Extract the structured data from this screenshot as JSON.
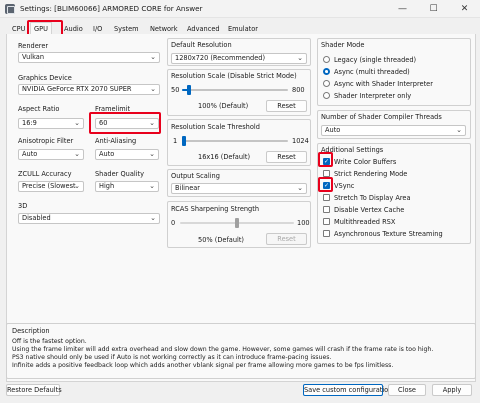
{
  "window": {
    "title": "Settings: [BLIM60066] ARMORED CORE for Answer",
    "min_glyph": "—",
    "max_glyph": "☐",
    "close_glyph": "✕"
  },
  "tabs": [
    "CPU",
    "GPU",
    "Audio",
    "I/O",
    "System",
    "Network",
    "Advanced",
    "Emulator"
  ],
  "renderer": {
    "label": "Renderer",
    "value": "Vulkan"
  },
  "graphics_device": {
    "label": "Graphics Device",
    "value": "NVIDIA GeForce RTX 2070 SUPER"
  },
  "aspect_ratio": {
    "label": "Aspect Ratio",
    "value": "16:9"
  },
  "framelimit": {
    "label": "Framelimit",
    "value": "60"
  },
  "anisotropic_filter": {
    "label": "Anisotropic Filter",
    "value": "Auto"
  },
  "anti_aliasing": {
    "label": "Anti-Aliasing",
    "value": "Auto"
  },
  "zcull_accuracy": {
    "label": "ZCULL Accuracy",
    "value": "Precise (Slowest"
  },
  "shader_quality": {
    "label": "Shader Quality",
    "value": "High"
  },
  "three_d": {
    "label": "3D",
    "value": "Disabled"
  },
  "default_resolution": {
    "label": "Default Resolution",
    "value": "1280x720 (Recommended)"
  },
  "resolution_scale": {
    "label": "Resolution Scale (Disable Strict Mode)",
    "min": "50",
    "max": "800",
    "value_text": "100% (Default)",
    "reset": "Reset",
    "min_val": 50,
    "max_val": 800,
    "value": 100
  },
  "resolution_scale_threshold": {
    "label": "Resolution Scale Threshold",
    "min": "1",
    "max": "1024",
    "value_text": "16x16 (Default)",
    "reset": "Reset",
    "min_val": 1,
    "max_val": 1024,
    "value": 16
  },
  "output_scaling": {
    "label": "Output Scaling",
    "value": "Bilinear"
  },
  "rcas_sharpening": {
    "label": "RCAS Sharpening Strength",
    "min": "0",
    "max": "100",
    "value_text": "50% (Default)",
    "reset": "Reset",
    "min_val": 0,
    "max_val": 100,
    "value": 50
  },
  "shader_mode": {
    "label": "Shader Mode",
    "options": [
      {
        "label": "Legacy (single threaded)",
        "selected": false
      },
      {
        "label": "Async (multi threaded)",
        "selected": true
      },
      {
        "label": "Async with Shader Interpreter",
        "selected": false
      },
      {
        "label": "Shader Interpreter only",
        "selected": false
      }
    ]
  },
  "compiler_threads": {
    "label": "Number of Shader Compiler Threads",
    "value": "Auto"
  },
  "additional_settings": {
    "label": "Additional Settings",
    "items": [
      {
        "label": "Write Color Buffers",
        "checked": true
      },
      {
        "label": "Strict Rendering Mode",
        "checked": false
      },
      {
        "label": "VSync",
        "checked": true
      },
      {
        "label": "Stretch To Display Area",
        "checked": false
      },
      {
        "label": "Disable Vertex Cache",
        "checked": false
      },
      {
        "label": "Multithreaded RSX",
        "checked": false
      },
      {
        "label": "Asynchronous Texture Streaming",
        "checked": false
      }
    ]
  },
  "description": {
    "label": "Description",
    "lines": [
      "Off is the fastest option.",
      "Using the frame limiter will add extra overhead and slow down the game. However, some games will crash if the frame rate is too high.",
      "PS3 native should only be used if Auto is not working correctly as it can introduce frame-pacing issues.",
      "Infinite adds a positive feedback loop which adds another vblank signal per frame allowing more games to be fps limitless."
    ]
  },
  "footer": {
    "restore": "Restore Defaults",
    "save": "Save custom configuration",
    "close": "Close",
    "apply": "Apply"
  },
  "colors": {
    "accent": "#0067c0",
    "highlight": "#e8001c"
  }
}
